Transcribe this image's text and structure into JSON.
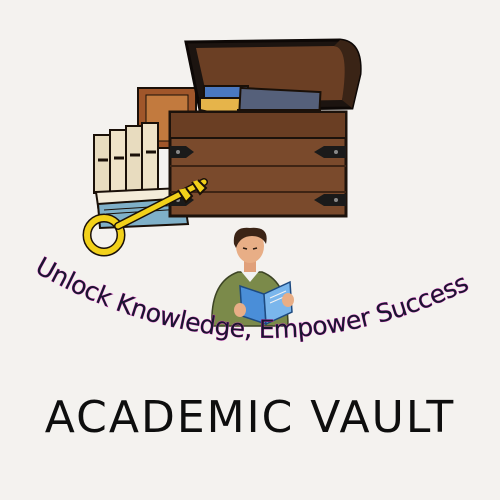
{
  "tagline": "Unlock Knowledge, Empower Success",
  "title": "ACADEMIC VAULT",
  "colors": {
    "background": "#f4f2ef",
    "chest_wood": "#7a4a2c",
    "chest_dark": "#4a2a18",
    "key_gold": "#f2d11a",
    "tagline_glow": "#e63ac8",
    "reader_shirt": "#7b8a4a",
    "book_blue": "#4a8ed8"
  },
  "icons": [
    "treasure-chest-icon",
    "key-icon",
    "book-stack-icon",
    "reading-person-icon"
  ]
}
